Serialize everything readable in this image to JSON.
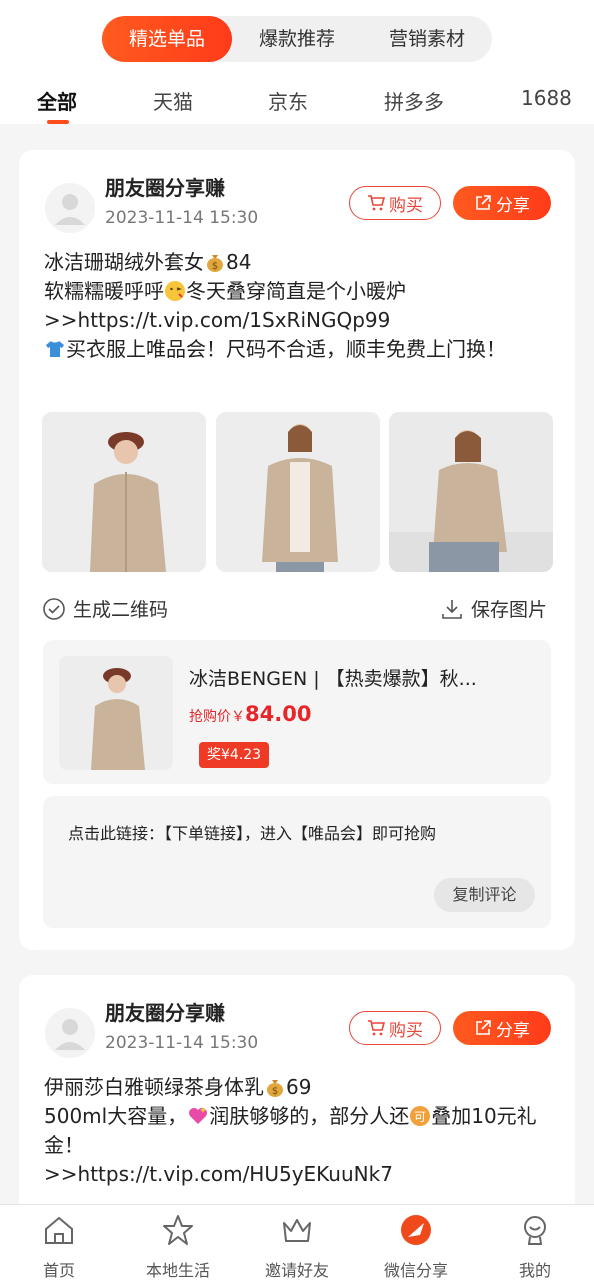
{
  "header": {
    "segments": [
      "精选单品",
      "爆款推荐",
      "营销素材"
    ],
    "tabs": [
      "全部",
      "天猫",
      "京东",
      "拼多多",
      "1688"
    ]
  },
  "posts": [
    {
      "title": "朋友圈分享赚",
      "time": "2023-11-14 15:30",
      "buy_label": "购买",
      "share_label": "分享",
      "line1": "冰洁珊瑚绒外套女",
      "price_amount": "84",
      "line2": "软糯糯暖呼呼",
      "line2b": "冬天叠穿简直是个小暖炉",
      "link": ">>https://t.vip.com/1SxRiNGQp99",
      "line4": "买衣服上唯品会！尺码不合适，顺丰免费上门换！",
      "qr_label": "生成二维码",
      "save_label": "保存图片",
      "product_name": "冰洁BENGEN | 【热卖爆款】秋...",
      "price_label": "抢购价￥",
      "price_value": "84.00",
      "reward": "奖¥4.23",
      "comment": "点击此链接：【下单链接】，进入【唯品会】即可抢购",
      "copy_label": "复制评论"
    },
    {
      "title": "朋友圈分享赚",
      "time": "2023-11-14 15:30",
      "buy_label": "购买",
      "share_label": "分享",
      "line1": "伊丽莎白雅顿绿茶身体乳",
      "price_amount": "69",
      "line2a": "500ml大容量，",
      "line2b": "润肤够够的，部分人还",
      "line2c": "叠加10元礼金！",
      "link": ">>https://t.vip.com/HU5yEKuuNk7"
    }
  ],
  "nav": [
    "首页",
    "本地生活",
    "邀请好友",
    "微信分享",
    "我的"
  ],
  "colors": {
    "accent": "#ff4d1c",
    "price": "#e8262a"
  }
}
